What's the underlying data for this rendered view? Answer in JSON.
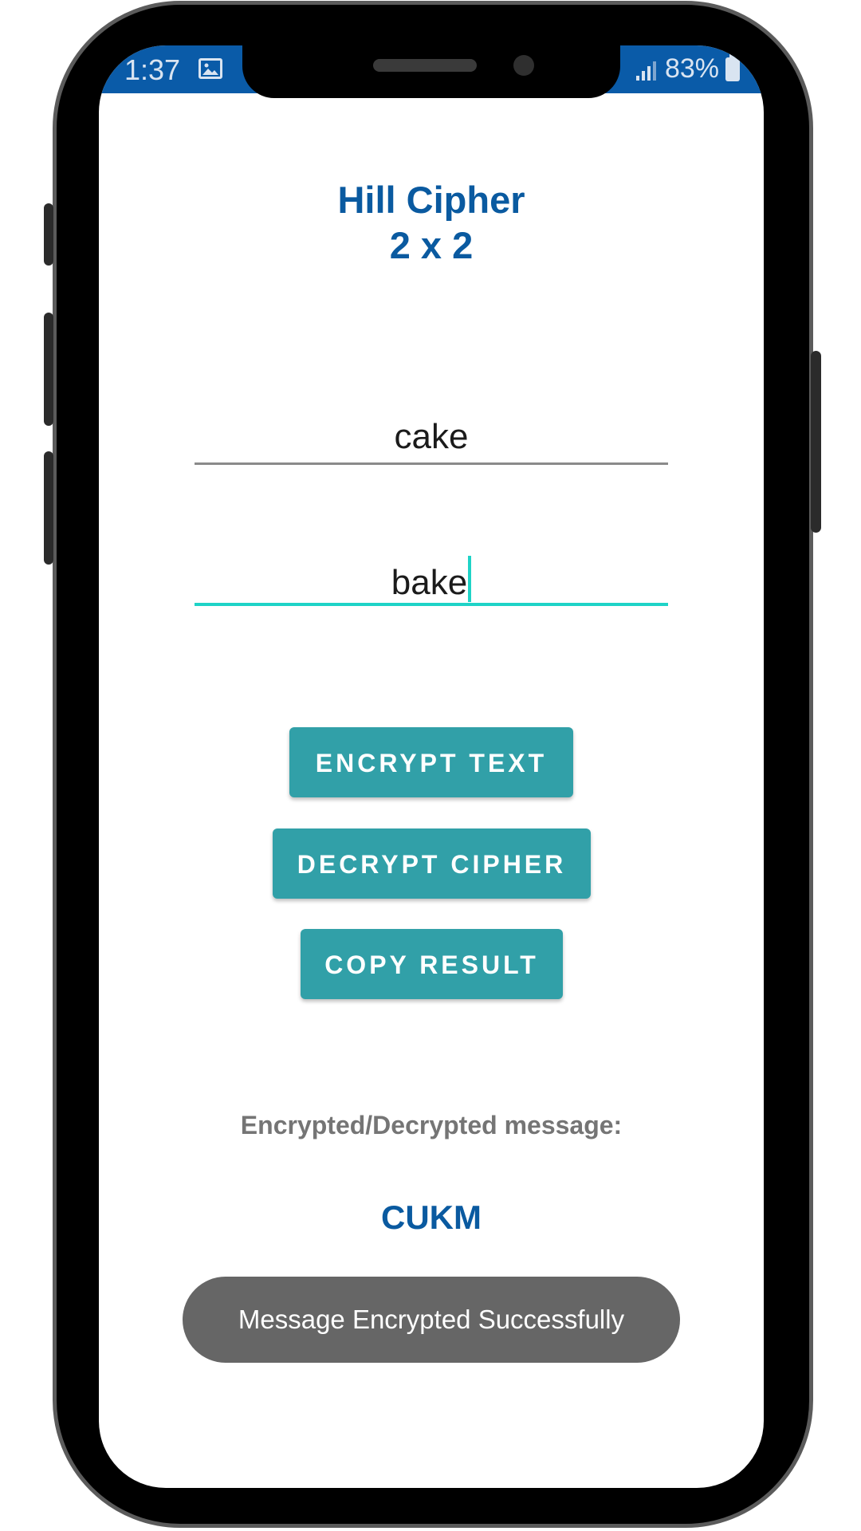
{
  "status_bar": {
    "time": "1:37",
    "battery": "83%",
    "background_color": "#0a5ba8",
    "icons": [
      "image-icon",
      "signal-icon",
      "battery-icon"
    ]
  },
  "app": {
    "title_line1": "Hill Cipher",
    "title_line2": "2 x 2",
    "title_color": "#0a5aa0"
  },
  "inputs": {
    "key": "cake",
    "message": "bake",
    "focused_color": "#1fd3c7"
  },
  "buttons": {
    "encrypt": "ENCRYPT TEXT",
    "decrypt": "DECRYPT CIPHER",
    "copy": "COPY RESULT",
    "color": "#31a0a8"
  },
  "result": {
    "label": "Encrypted/Decrypted message:",
    "value": "CUKM"
  },
  "toast": {
    "message": "Message Encrypted Successfully"
  }
}
